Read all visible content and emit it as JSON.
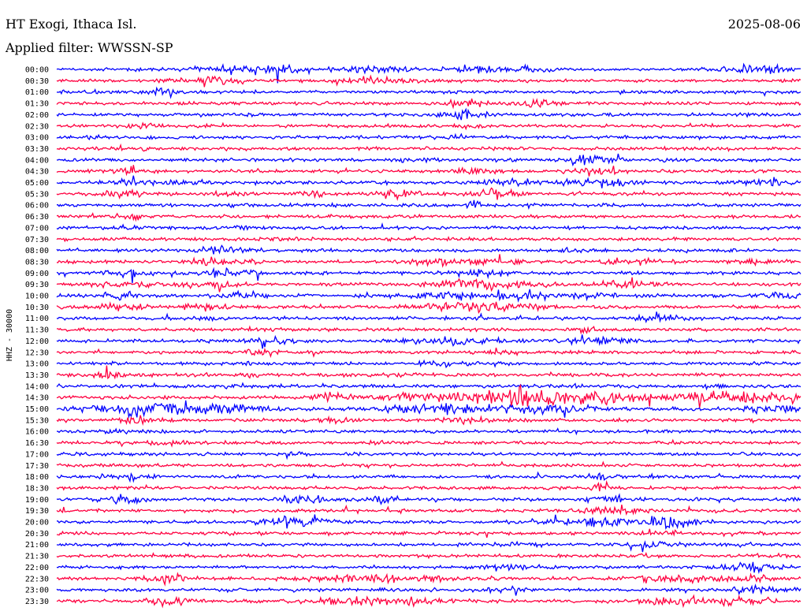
{
  "header": {
    "station": "HT Exogi, Ithaca Isl.",
    "date": "2025-08-06",
    "filter": "Applied filter: WWSSN-SP"
  },
  "chart_data": {
    "type": "line",
    "title": "HT Exogi, Ithaca Isl.",
    "subtitle": "Applied filter: WWSSN-SP",
    "date": "2025-08-06",
    "ylabel": "HHZ - 30000",
    "row_labels": [
      "00:00",
      "00:30",
      "01:00",
      "01:30",
      "02:00",
      "02:30",
      "03:00",
      "03:30",
      "04:00",
      "04:30",
      "05:00",
      "05:30",
      "06:00",
      "06:30",
      "07:00",
      "07:30",
      "08:00",
      "08:30",
      "09:00",
      "09:30",
      "10:00",
      "10:30",
      "11:00",
      "11:30",
      "12:00",
      "12:30",
      "13:00",
      "13:30",
      "14:00",
      "14:30",
      "15:00",
      "15:30",
      "16:00",
      "16:30",
      "17:00",
      "17:30",
      "18:00",
      "18:30",
      "19:00",
      "19:30",
      "20:00",
      "20:30",
      "21:00",
      "21:30",
      "22:00",
      "22:30",
      "23:00",
      "23:30"
    ],
    "colors": {
      "even_rows": "#0000ff",
      "odd_rows": "#ff0040"
    },
    "activity": [
      [
        0.25,
        0.04,
        0.12,
        0.9
      ],
      [
        0.31,
        0.02,
        0.1,
        0.8
      ],
      [
        0.42,
        0.03,
        0.1,
        0.7
      ],
      [
        0.57,
        0.03,
        0.1,
        0.7
      ],
      [
        0.64,
        0.02,
        0.1,
        0.5
      ],
      [
        0.94,
        0.03,
        0.15,
        0.9
      ],
      [
        0.21,
        0.03,
        0.1,
        0.9
      ],
      [
        0.44,
        0.03,
        0.1,
        0.8
      ],
      [
        0.14,
        0.02,
        0.1,
        0.7
      ],
      [
        0.55,
        0.02,
        0.13,
        0.8
      ],
      [
        0.65,
        0.02,
        0.13,
        0.5
      ],
      [
        0.54,
        0.02,
        0.16,
        0.7
      ],
      [
        0.12,
        0.01,
        0.06,
        0.4
      ],
      [
        0.55,
        0.01,
        0.07,
        0.4
      ],
      [
        0.05,
        0.02,
        0.04,
        0.4
      ],
      [
        0.54,
        0.01,
        0.08,
        0.3
      ],
      [
        0.11,
        0.01,
        0.05,
        0.4
      ],
      [
        0.72,
        0.02,
        0.14,
        0.5
      ],
      [
        0.48,
        0.02,
        0.05,
        0.3
      ],
      [
        0.09,
        0.02,
        0.1,
        0.6
      ],
      [
        0.57,
        0.02,
        0.1,
        0.4
      ],
      [
        0.72,
        0.02,
        0.1,
        0.4
      ],
      [
        0.09,
        0.02,
        0.1,
        0.7
      ],
      [
        0.17,
        0.02,
        0.11,
        0.8
      ],
      [
        0.6,
        0.03,
        0.12,
        0.8
      ],
      [
        0.73,
        0.03,
        0.11,
        0.8
      ],
      [
        0.95,
        0.03,
        0.1,
        0.5
      ],
      [
        0.09,
        0.02,
        0.14,
        0.8
      ],
      [
        0.23,
        0.01,
        0.1,
        0.5
      ],
      [
        0.34,
        0.01,
        0.1,
        0.4
      ],
      [
        0.46,
        0.02,
        0.13,
        0.6
      ],
      [
        0.59,
        0.02,
        0.16,
        0.6
      ],
      [
        0.56,
        0.01,
        0.08,
        0.4
      ],
      [
        0.25,
        0.02,
        0.05,
        0.3
      ],
      [
        0.09,
        0.02,
        0.05,
        0.3
      ],
      [
        0.44,
        0.01,
        0.04,
        0.3
      ],
      [
        0.09,
        0.01,
        0.05,
        0.3
      ],
      [
        0.25,
        0.01,
        0.05,
        0.3
      ],
      [
        0.31,
        0.01,
        0.08,
        0.3
      ],
      [
        0.22,
        0.02,
        0.13,
        0.6
      ],
      [
        0.69,
        0.01,
        0.08,
        0.4
      ],
      [
        0.21,
        0.03,
        0.12,
        0.7
      ],
      [
        0.51,
        0.03,
        0.09,
        0.5
      ],
      [
        0.59,
        0.02,
        0.09,
        0.6
      ],
      [
        0.78,
        0.03,
        0.08,
        0.6
      ],
      [
        0.94,
        0.02,
        0.08,
        0.4
      ],
      [
        0.09,
        0.02,
        0.12,
        0.8
      ],
      [
        0.23,
        0.03,
        0.12,
        0.9
      ],
      [
        0.57,
        0.03,
        0.09,
        0.8
      ],
      [
        0.09,
        0.03,
        0.12,
        0.8
      ],
      [
        0.21,
        0.03,
        0.11,
        0.8
      ],
      [
        0.55,
        0.04,
        0.1,
        0.8
      ],
      [
        0.6,
        0.05,
        0.1,
        0.9
      ],
      [
        0.76,
        0.03,
        0.09,
        0.4
      ],
      [
        0.09,
        0.02,
        0.12,
        0.7
      ],
      [
        0.24,
        0.03,
        0.1,
        0.8
      ],
      [
        0.53,
        0.03,
        0.1,
        0.8
      ],
      [
        0.61,
        0.03,
        0.12,
        0.8
      ],
      [
        0.72,
        0.02,
        0.09,
        0.7
      ],
      [
        0.97,
        0.02,
        0.1,
        0.6
      ],
      [
        0.09,
        0.02,
        0.14,
        0.8
      ],
      [
        0.2,
        0.02,
        0.12,
        0.8
      ],
      [
        0.52,
        0.03,
        0.12,
        0.6
      ],
      [
        0.6,
        0.04,
        0.14,
        0.7
      ],
      [
        0.21,
        0.01,
        0.05,
        0.4
      ],
      [
        0.55,
        0.01,
        0.05,
        0.3
      ],
      [
        0.81,
        0.02,
        0.14,
        0.6
      ],
      [
        0.27,
        0.02,
        0.05,
        0.4
      ],
      [
        0.71,
        0.01,
        0.1,
        0.3
      ],
      [
        0.29,
        0.02,
        0.14,
        0.7
      ],
      [
        0.53,
        0.04,
        0.12,
        0.8
      ],
      [
        0.73,
        0.03,
        0.12,
        0.8
      ],
      [
        0.28,
        0.02,
        0.1,
        0.6
      ],
      [
        0.59,
        0.01,
        0.1,
        0.4
      ],
      [
        0.52,
        0.02,
        0.1,
        0.4
      ],
      [
        0.26,
        0.02,
        0.04,
        0.3
      ],
      [
        0.07,
        0.02,
        0.1,
        0.5
      ],
      [
        0.26,
        0.01,
        0.04,
        0.3
      ],
      [
        0.45,
        0.02,
        0.04,
        0.4
      ],
      [
        0.24,
        0.03,
        0.04,
        0.3
      ],
      [
        0.89,
        0.02,
        0.04,
        0.3
      ],
      [
        0.37,
        0.02,
        0.18,
        0.6
      ],
      [
        0.52,
        0.06,
        0.18,
        0.7
      ],
      [
        0.63,
        0.03,
        0.18,
        0.6
      ],
      [
        0.71,
        0.08,
        0.18,
        0.7
      ],
      [
        0.9,
        0.04,
        0.18,
        0.6
      ],
      [
        0.98,
        0.02,
        0.18,
        0.6
      ],
      [
        0.1,
        0.04,
        0.18,
        0.8
      ],
      [
        0.19,
        0.06,
        0.16,
        0.7
      ],
      [
        0.52,
        0.05,
        0.18,
        0.8
      ],
      [
        0.66,
        0.04,
        0.15,
        0.6
      ],
      [
        0.97,
        0.03,
        0.12,
        0.6
      ],
      [
        0.11,
        0.02,
        0.11,
        0.6
      ],
      [
        0.37,
        0.02,
        0.08,
        0.4
      ],
      [
        0.55,
        0.02,
        0.08,
        0.4
      ],
      [
        0.09,
        0.02,
        0.04,
        0.3
      ],
      [
        0.98,
        0.01,
        0.04,
        0.3
      ],
      [
        0.15,
        0.02,
        0.05,
        0.4
      ],
      [
        0.43,
        0.01,
        0.04,
        0.3
      ],
      [
        0.32,
        0.01,
        0.04,
        0.3
      ],
      [
        0.03,
        0.01,
        0.03,
        0.2
      ],
      [
        0.1,
        0.02,
        0.1,
        0.6
      ],
      [
        0.73,
        0.01,
        0.12,
        0.6
      ],
      [
        0.73,
        0.01,
        0.1,
        0.6
      ],
      [
        0.73,
        0.01,
        0.04,
        0.3
      ],
      [
        0.09,
        0.02,
        0.13,
        0.7
      ],
      [
        0.33,
        0.02,
        0.15,
        0.8
      ],
      [
        0.43,
        0.02,
        0.1,
        0.6
      ],
      [
        0.74,
        0.02,
        0.16,
        0.8
      ],
      [
        0.74,
        0.03,
        0.13,
        0.6
      ],
      [
        0.77,
        0.02,
        0.08,
        0.5
      ],
      [
        0.32,
        0.03,
        0.16,
        0.8
      ],
      [
        0.73,
        0.04,
        0.14,
        0.9
      ],
      [
        0.81,
        0.02,
        0.12,
        0.6
      ],
      [
        0.84,
        0.02,
        0.12,
        0.6
      ],
      [
        0.23,
        0.01,
        0.05,
        0.3
      ],
      [
        0.8,
        0.02,
        0.1,
        0.5
      ],
      [
        0.62,
        0.03,
        0.04,
        0.3
      ],
      [
        0.8,
        0.02,
        0.1,
        0.5
      ],
      [
        0.79,
        0.01,
        0.05,
        0.3
      ],
      [
        0.98,
        0.01,
        0.04,
        0.3
      ],
      [
        0.6,
        0.02,
        0.09,
        0.5
      ],
      [
        0.94,
        0.02,
        0.14,
        0.8
      ],
      [
        0.93,
        0.03,
        0.08,
        0.5
      ],
      [
        0.15,
        0.02,
        0.16,
        0.8
      ],
      [
        0.43,
        0.06,
        0.14,
        0.9
      ],
      [
        0.84,
        0.04,
        0.14,
        0.8
      ],
      [
        0.93,
        0.02,
        0.14,
        0.8
      ]
    ]
  }
}
